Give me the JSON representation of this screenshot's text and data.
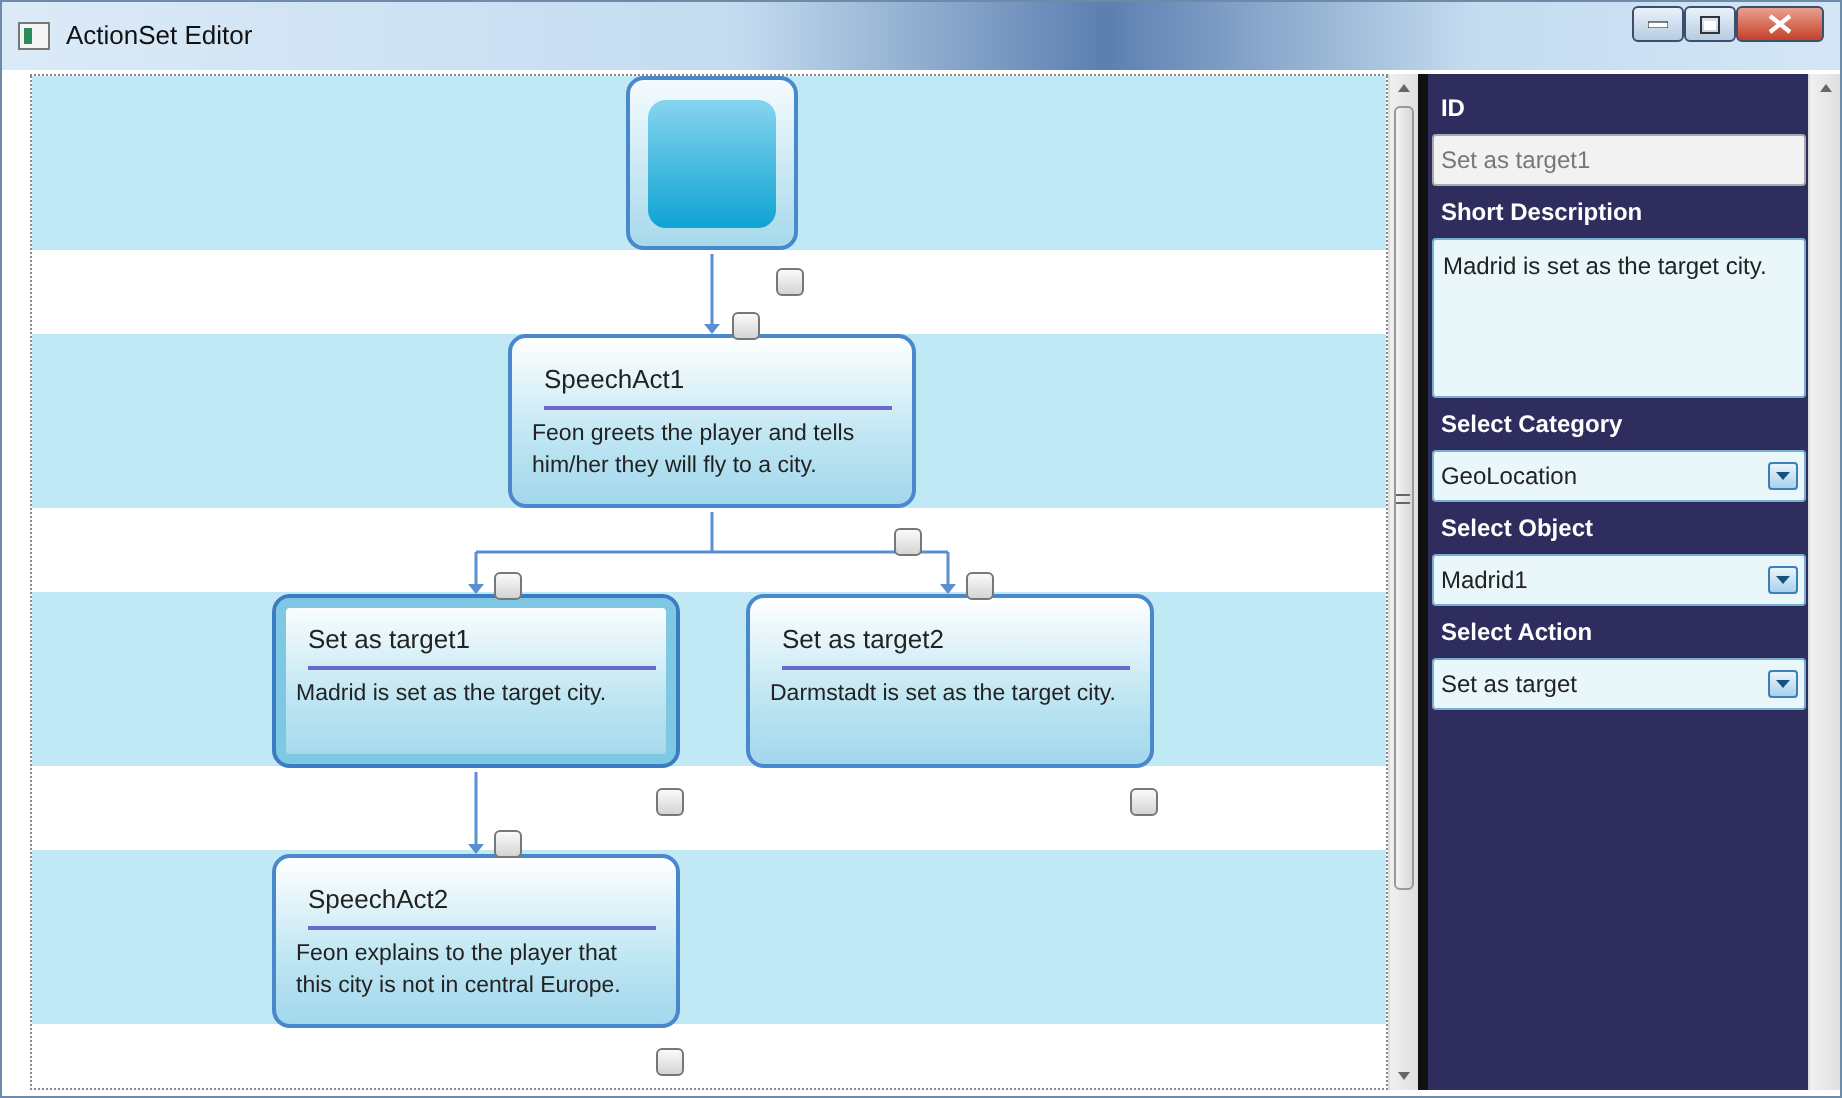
{
  "window": {
    "title": "ActionSet Editor"
  },
  "nodes": [
    {
      "kind": "start",
      "selected": false,
      "out_checked": false
    },
    {
      "kind": "speech",
      "title": "SpeechAct1",
      "text": "Feon greets the player and tells him/her they will fly to a city.",
      "selected": false,
      "in_checked": false,
      "out_checked": false
    },
    {
      "kind": "action",
      "title": "Set as target1",
      "text": "Madrid is set as the target city.",
      "selected": true,
      "in_checked": false,
      "out_checked": false
    },
    {
      "kind": "action",
      "title": "Set as target2",
      "text": "Darmstadt is set as the target city.",
      "selected": false,
      "in_checked": false,
      "out_checked": false
    },
    {
      "kind": "speech",
      "title": "SpeechAct2",
      "text": "Feon explains to the player that this city is not in central Europe.",
      "selected": false,
      "in_checked": false,
      "out_checked": false
    }
  ],
  "panel": [
    {
      "kind": "text",
      "label": "ID",
      "value": "Set as target1"
    },
    {
      "kind": "textarea",
      "label": "Short Description",
      "value": "Madrid is set as the target city."
    },
    {
      "kind": "select",
      "label": "Select Category",
      "value": "GeoLocation"
    },
    {
      "kind": "select",
      "label": "Select Object",
      "value": "Madrid1"
    },
    {
      "kind": "select",
      "label": "Select Action",
      "value": "Set as target"
    }
  ]
}
